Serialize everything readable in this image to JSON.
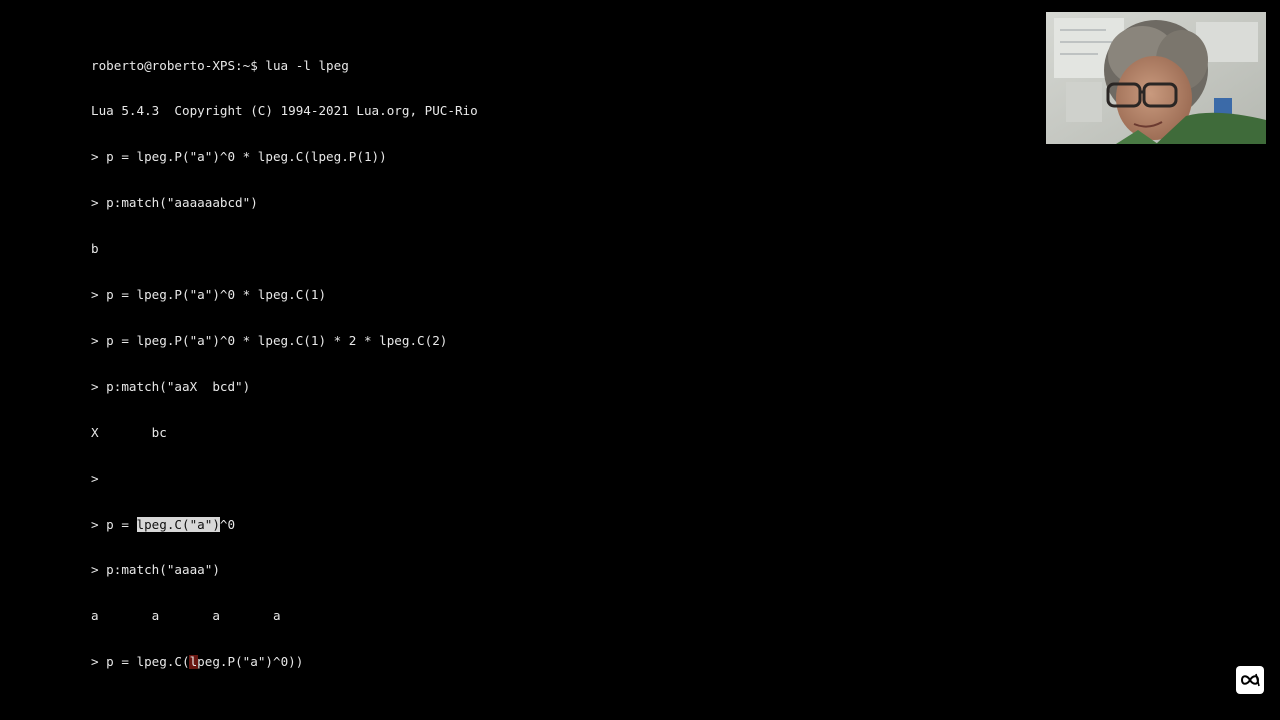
{
  "terminal": {
    "lines": [
      "roberto@roberto-XPS:~$ lua -l lpeg",
      "Lua 5.4.3  Copyright (C) 1994-2021 Lua.org, PUC-Rio",
      "> p = lpeg.P(\"a\")^0 * lpeg.C(lpeg.P(1))",
      "> p:match(\"aaaaaabcd\")",
      "b",
      "> p = lpeg.P(\"a\")^0 * lpeg.C(1)",
      "> p = lpeg.P(\"a\")^0 * lpeg.C(1) * 2 * lpeg.C(2)",
      "> p:match(\"aaX  bcd\")",
      "X       bc",
      ">"
    ],
    "line11": {
      "prefix": "> p = ",
      "selected": "lpeg.C(\"a\")",
      "suffix": "^0"
    },
    "line12": "> p:match(\"aaaa\")",
    "line13": "a       a       a       a",
    "current": {
      "before": "> p = lpeg.C(",
      "cursor_char": "l",
      "after": "peg.P(\"a\")^0))"
    }
  },
  "webcam": {
    "icon": "presenter-webcam"
  },
  "badge": {
    "icon": "channel-logo-icon"
  }
}
